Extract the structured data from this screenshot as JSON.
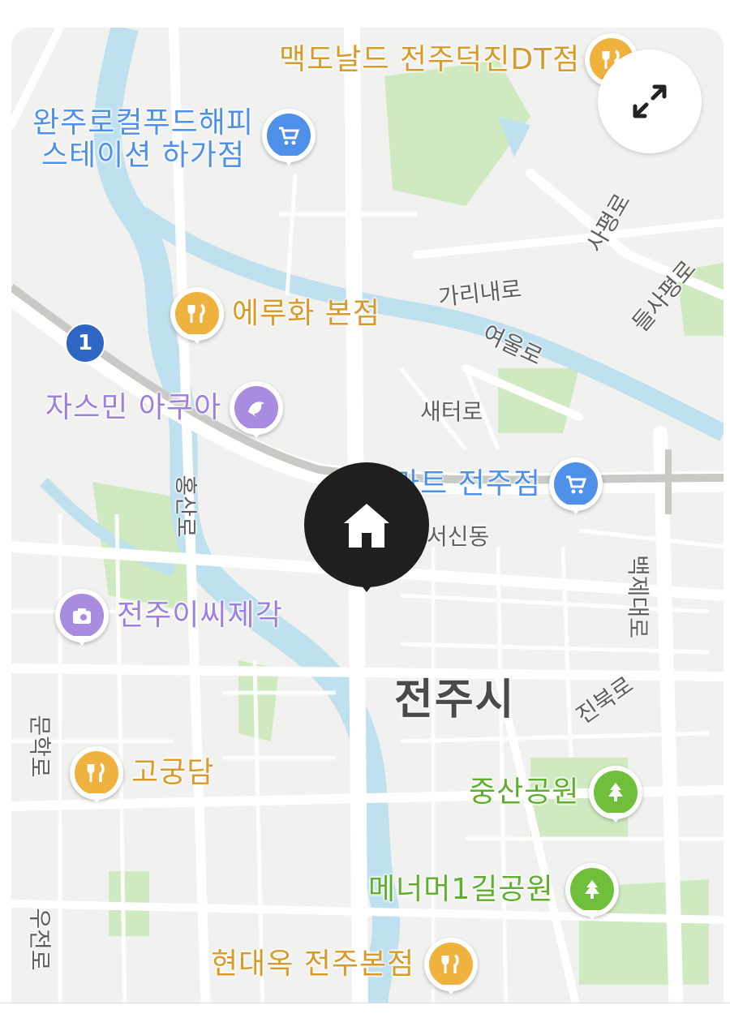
{
  "map": {
    "city_label": "전주시",
    "route_badge": "1",
    "expand_button_icon": "expand-icon",
    "home_marker_icon": "home-icon",
    "colors": {
      "restaurant": "#f0b23e",
      "shopping": "#4f90e8",
      "leisure": "#a98be0",
      "park": "#6fbf3b",
      "water": "#bfe0ef",
      "greenery": "#cfeac0",
      "marker": "#1f1f1f"
    },
    "pois": [
      {
        "label": "맥도날드 전주덕진DT점",
        "category": "restaurant",
        "icon": "fork-knife-icon"
      },
      {
        "label": "완주로컬푸드해피\n스테이션 하가점",
        "category": "shopping",
        "icon": "cart-icon"
      },
      {
        "label": "에루화 본점",
        "category": "restaurant",
        "icon": "fork-knife-icon"
      },
      {
        "label": "자스민 아쿠아",
        "category": "leisure",
        "icon": "dolphin-icon"
      },
      {
        "label": "마트 전주점",
        "category": "shopping",
        "icon": "cart-icon"
      },
      {
        "label": "전주이씨제각",
        "category": "leisure",
        "icon": "camera-icon"
      },
      {
        "label": "고궁담",
        "category": "restaurant",
        "icon": "fork-knife-icon"
      },
      {
        "label": "중산공원",
        "category": "park",
        "icon": "tree-icon"
      },
      {
        "label": "메너머1길공원",
        "category": "park",
        "icon": "tree-icon"
      },
      {
        "label": "현대옥 전주본점",
        "category": "restaurant",
        "icon": "fork-knife-icon"
      }
    ],
    "roads": [
      "사평로",
      "들사평로",
      "가리내로",
      "여울로",
      "새터로",
      "홍산로",
      "서신동",
      "백제대로",
      "진북로",
      "문학로",
      "우전로"
    ]
  }
}
